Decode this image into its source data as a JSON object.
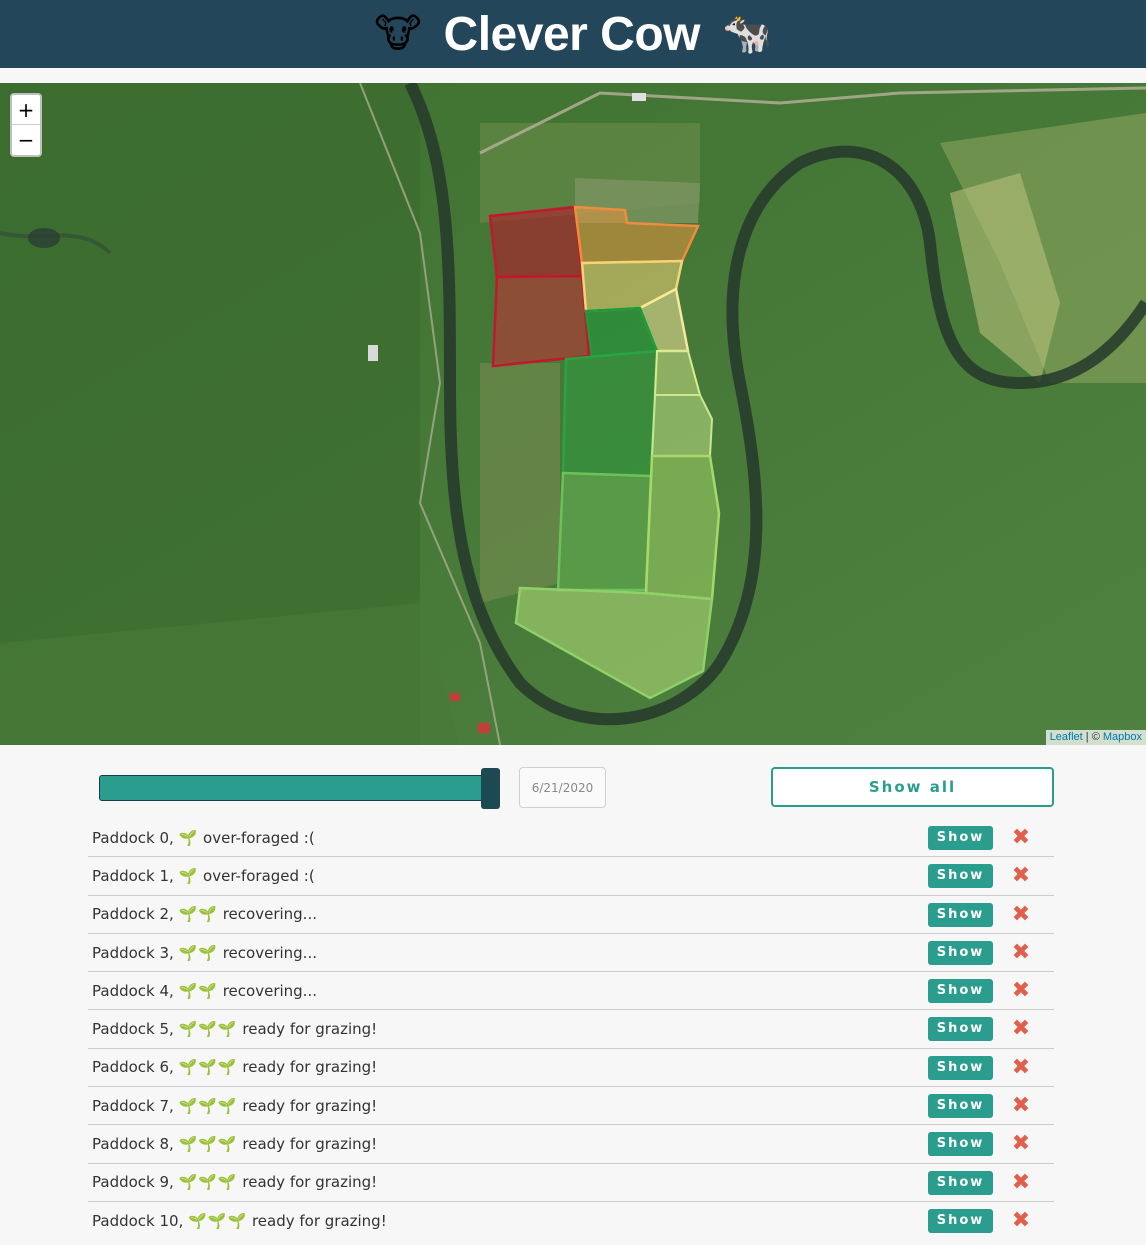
{
  "header": {
    "title": "Clever Cow",
    "left_emoji": "🐮",
    "right_emoji": "🐄"
  },
  "map": {
    "zoom_in_label": "+",
    "zoom_out_label": "−",
    "attribution_leaflet": "Leaflet",
    "attribution_sep": " | © ",
    "attribution_mapbox": "Mapbox"
  },
  "controls": {
    "date": "6/21/2020",
    "slider_value_fraction": 1.0,
    "show_all_label": "Show all"
  },
  "paddocks": [
    {
      "name": "Paddock 0,",
      "sprouts": "🌱",
      "status": "over-foraged :(",
      "show_label": "Show",
      "color": "#c0182c"
    },
    {
      "name": "Paddock 1,",
      "sprouts": "🌱",
      "status": "over-foraged :(",
      "show_label": "Show",
      "color": "#c8282e"
    },
    {
      "name": "Paddock 2,",
      "sprouts": "🌱🌱",
      "status": "recovering...",
      "show_label": "Show",
      "color": "#f08c3c"
    },
    {
      "name": "Paddock 3,",
      "sprouts": "🌱🌱",
      "status": "recovering...",
      "show_label": "Show",
      "color": "#f4d478"
    },
    {
      "name": "Paddock 4,",
      "sprouts": "🌱🌱",
      "status": "recovering...",
      "show_label": "Show",
      "color": "#f7e89c"
    },
    {
      "name": "Paddock 5,",
      "sprouts": "🌱🌱🌱",
      "status": "ready for grazing!",
      "show_label": "Show",
      "color": "#1f9a3c"
    },
    {
      "name": "Paddock 6,",
      "sprouts": "🌱🌱🌱",
      "status": "ready for grazing!",
      "show_label": "Show",
      "color": "#2aa343"
    },
    {
      "name": "Paddock 7,",
      "sprouts": "🌱🌱🌱",
      "status": "ready for grazing!",
      "show_label": "Show",
      "color": "#6cc25a"
    },
    {
      "name": "Paddock 8,",
      "sprouts": "🌱🌱🌱",
      "status": "ready for grazing!",
      "show_label": "Show",
      "color": "#b6e07a"
    },
    {
      "name": "Paddock 9,",
      "sprouts": "🌱🌱🌱",
      "status": "ready for grazing!",
      "show_label": "Show",
      "color": "#c9e88c"
    },
    {
      "name": "Paddock 10,",
      "sprouts": "🌱🌱🌱",
      "status": "ready for grazing!",
      "show_label": "Show",
      "color": "#a6d96a"
    }
  ],
  "delete_icon": "✖"
}
